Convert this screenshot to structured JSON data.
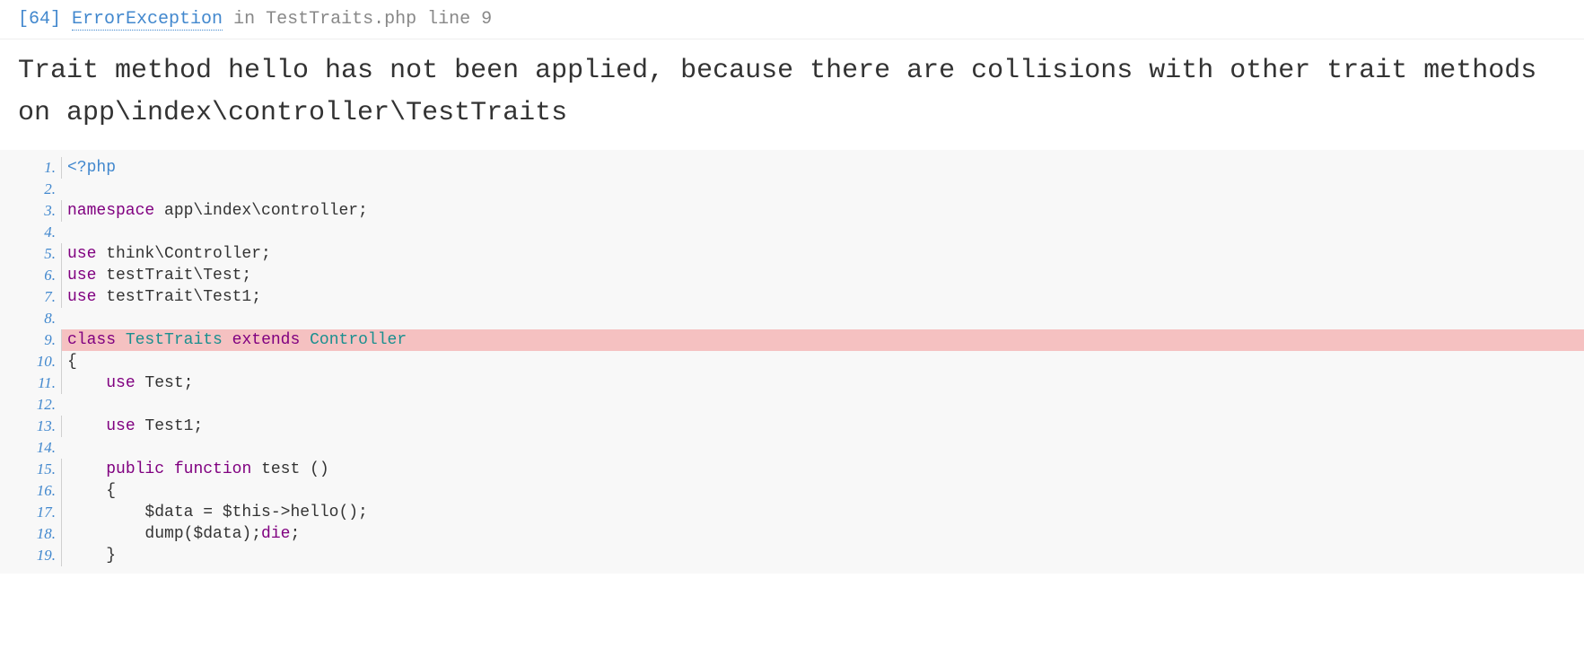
{
  "header": {
    "error_code": "[64]",
    "exception_name": "ErrorException",
    "in_word": "in",
    "location": "TestTraits.php line 9"
  },
  "message": "Trait method hello has not been applied, because there are collisions with other trait methods on app\\index\\controller\\TestTraits",
  "source": {
    "highlight_line": 9,
    "lines": [
      {
        "n": "1.",
        "tokens": [
          {
            "c": "tok-meta",
            "t": "<?php"
          }
        ]
      },
      {
        "n": "2.",
        "tokens": []
      },
      {
        "n": "3.",
        "tokens": [
          {
            "c": "tok-keyword",
            "t": "namespace"
          },
          {
            "c": "tok-default",
            "t": " app\\index\\controller;"
          }
        ]
      },
      {
        "n": "4.",
        "tokens": []
      },
      {
        "n": "5.",
        "tokens": [
          {
            "c": "tok-keyword",
            "t": "use"
          },
          {
            "c": "tok-default",
            "t": " think\\Controller;"
          }
        ]
      },
      {
        "n": "6.",
        "tokens": [
          {
            "c": "tok-keyword",
            "t": "use"
          },
          {
            "c": "tok-default",
            "t": " testTrait\\Test;"
          }
        ]
      },
      {
        "n": "7.",
        "tokens": [
          {
            "c": "tok-keyword",
            "t": "use"
          },
          {
            "c": "tok-default",
            "t": " testTrait\\Test1;"
          }
        ]
      },
      {
        "n": "8.",
        "tokens": []
      },
      {
        "n": "9.",
        "tokens": [
          {
            "c": "tok-keyword",
            "t": "class"
          },
          {
            "c": "tok-default",
            "t": " "
          },
          {
            "c": "tok-class",
            "t": "TestTraits"
          },
          {
            "c": "tok-default",
            "t": " "
          },
          {
            "c": "tok-keyword",
            "t": "extends"
          },
          {
            "c": "tok-default",
            "t": " "
          },
          {
            "c": "tok-class",
            "t": "Controller"
          }
        ]
      },
      {
        "n": "10.",
        "tokens": [
          {
            "c": "tok-default",
            "t": "{"
          }
        ]
      },
      {
        "n": "11.",
        "tokens": [
          {
            "c": "tok-default",
            "t": "    "
          },
          {
            "c": "tok-keyword",
            "t": "use"
          },
          {
            "c": "tok-default",
            "t": " Test;"
          }
        ]
      },
      {
        "n": "12.",
        "tokens": []
      },
      {
        "n": "13.",
        "tokens": [
          {
            "c": "tok-default",
            "t": "    "
          },
          {
            "c": "tok-keyword",
            "t": "use"
          },
          {
            "c": "tok-default",
            "t": " Test1;"
          }
        ]
      },
      {
        "n": "14.",
        "tokens": []
      },
      {
        "n": "15.",
        "tokens": [
          {
            "c": "tok-default",
            "t": "    "
          },
          {
            "c": "tok-keyword",
            "t": "public"
          },
          {
            "c": "tok-default",
            "t": " "
          },
          {
            "c": "tok-keyword",
            "t": "function"
          },
          {
            "c": "tok-default",
            "t": " test ()"
          }
        ]
      },
      {
        "n": "16.",
        "tokens": [
          {
            "c": "tok-default",
            "t": "    {"
          }
        ]
      },
      {
        "n": "17.",
        "tokens": [
          {
            "c": "tok-default",
            "t": "        $data = $this->hello();"
          }
        ]
      },
      {
        "n": "18.",
        "tokens": [
          {
            "c": "tok-default",
            "t": "        dump($data);"
          },
          {
            "c": "tok-keyword",
            "t": "die"
          },
          {
            "c": "tok-default",
            "t": ";"
          }
        ]
      },
      {
        "n": "19.",
        "tokens": [
          {
            "c": "tok-default",
            "t": "    }"
          }
        ]
      }
    ]
  }
}
